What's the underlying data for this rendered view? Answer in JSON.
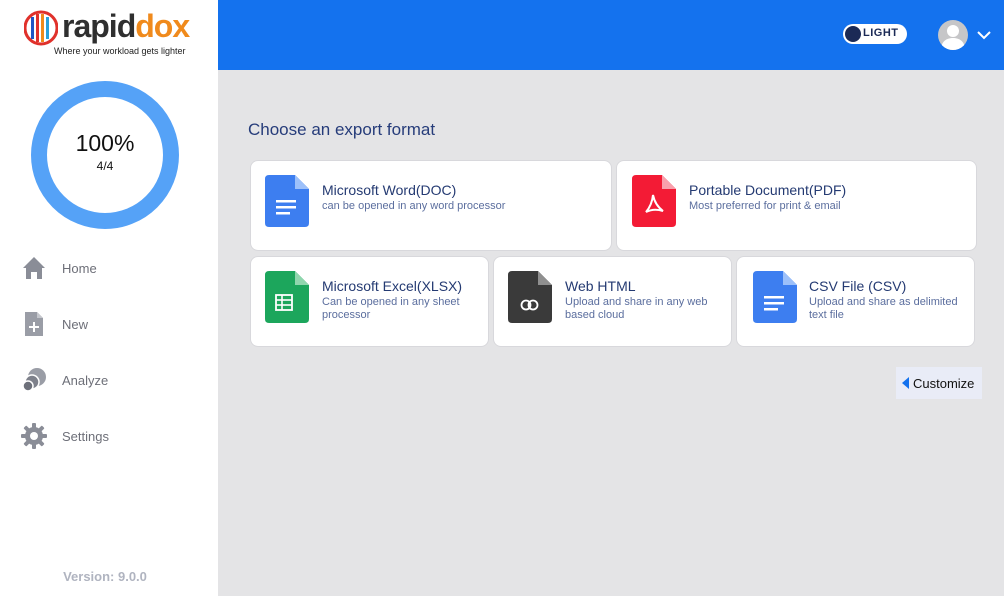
{
  "brand": {
    "name_part1": "rapid",
    "name_part2": "dox",
    "tagline": "Where your workload gets lighter"
  },
  "progress": {
    "percent_text": "100%",
    "count_text": "4/4",
    "fraction": 1.0,
    "ring_color": "#55a2f7"
  },
  "sidebar": {
    "items": [
      {
        "label": "Home",
        "icon": "home-icon"
      },
      {
        "label": "New",
        "icon": "new-document-icon"
      },
      {
        "label": "Analyze",
        "icon": "analyze-icon"
      },
      {
        "label": "Settings",
        "icon": "gear-icon"
      }
    ],
    "version": "Version: 9.0.0"
  },
  "header": {
    "theme_label": "LIGHT",
    "accent": "#1472ee"
  },
  "main": {
    "title": "Choose an export format",
    "formats": [
      {
        "title": "Microsoft Word(DOC)",
        "desc": "can be opened in any word processor",
        "icon": "word-doc-icon",
        "color": "#3d7ef0"
      },
      {
        "title": "Portable Document(PDF)",
        "desc": "Most preferred for print & email",
        "icon": "pdf-icon",
        "color": "#f31b35"
      },
      {
        "title": "Microsoft Excel(XLSX)",
        "desc": "Can be opened in any sheet processor",
        "icon": "excel-sheet-icon",
        "color": "#1ca65c"
      },
      {
        "title": "Web HTML",
        "desc": "Upload and share in any web based cloud",
        "icon": "html-link-icon",
        "color": "#3a3a3a"
      },
      {
        "title": "CSV File (CSV)",
        "desc": "Upload and share as delimited text file",
        "icon": "csv-doc-icon",
        "color": "#3d7ef0"
      }
    ],
    "customize_label": "Customize"
  }
}
